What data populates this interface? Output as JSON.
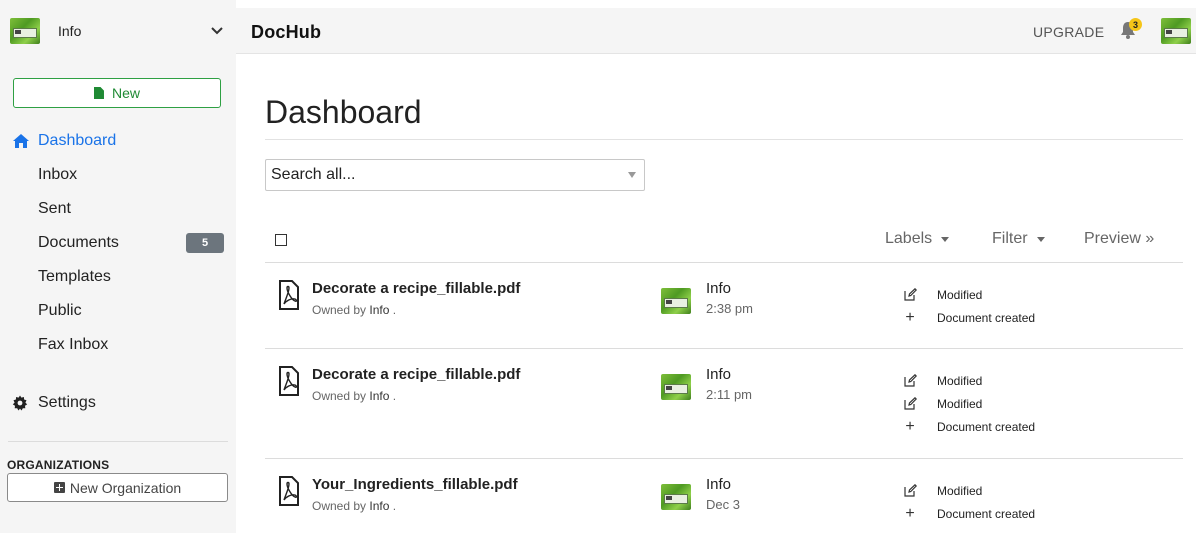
{
  "account": {
    "name": "Info"
  },
  "sidebar": {
    "new_label": "New",
    "items": [
      {
        "label": "Dashboard",
        "active": true
      },
      {
        "label": "Inbox"
      },
      {
        "label": "Sent"
      },
      {
        "label": "Documents",
        "badge": "5"
      },
      {
        "label": "Templates"
      },
      {
        "label": "Public"
      },
      {
        "label": "Fax Inbox"
      }
    ],
    "settings_label": "Settings",
    "organizations_heading": "ORGANIZATIONS",
    "new_org_label": "New Organization"
  },
  "topbar": {
    "brand": "DocHub",
    "upgrade_label": "UPGRADE",
    "notification_count": "3"
  },
  "main": {
    "title": "Dashboard",
    "search_placeholder": "Search all...",
    "toolbar": {
      "labels": "Labels",
      "filter": "Filter",
      "preview": "Preview »"
    }
  },
  "documents": [
    {
      "name": "Decorate a recipe_fillable.pdf",
      "owned_prefix": "Owned by",
      "owner": "Info",
      "owned_suffix": " .",
      "user": "Info",
      "time": "2:38 pm",
      "activity": [
        {
          "icon": "edit-icon",
          "text": "Modified"
        },
        {
          "icon": "plus-icon",
          "text": "Document created"
        }
      ]
    },
    {
      "name": "Decorate a recipe_fillable.pdf",
      "owned_prefix": "Owned by",
      "owner": "Info",
      "owned_suffix": " .",
      "user": "Info",
      "time": "2:11 pm",
      "activity": [
        {
          "icon": "edit-icon",
          "text": "Modified"
        },
        {
          "icon": "edit-icon",
          "text": "Modified"
        },
        {
          "icon": "plus-icon",
          "text": "Document created"
        }
      ]
    },
    {
      "name": "Your_Ingredients_fillable.pdf",
      "owned_prefix": "Owned by",
      "owner": "Info",
      "owned_suffix": " .",
      "user": "Info",
      "time": "Dec 3",
      "activity": [
        {
          "icon": "edit-icon",
          "text": "Modified"
        },
        {
          "icon": "plus-icon",
          "text": "Document created"
        }
      ]
    }
  ],
  "colors": {
    "accent": "#1a73e8",
    "new_button": "#2ea043",
    "badge": "#6c757d",
    "notification": "#f5c518"
  }
}
